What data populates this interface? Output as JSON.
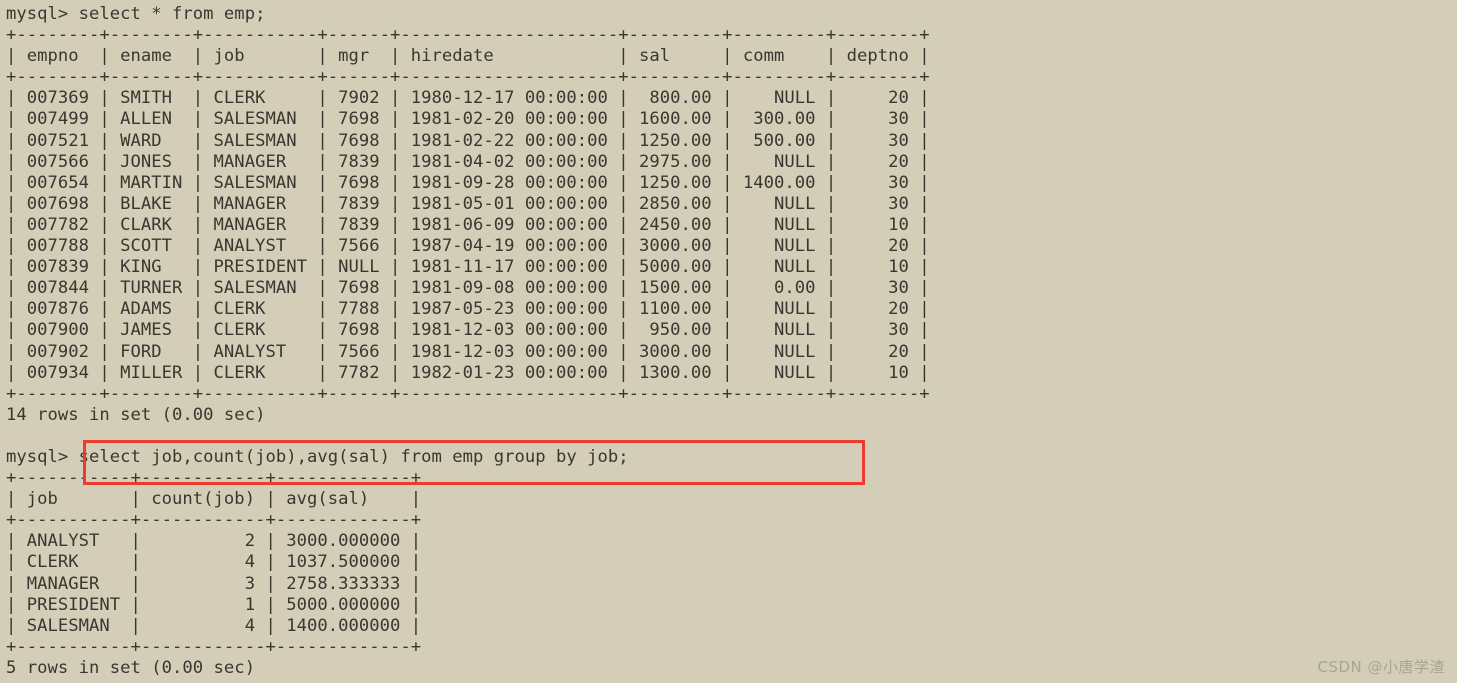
{
  "terminal": {
    "background_color": "#d4cdb8",
    "text_color": "#3b3630",
    "highlight_color": "#ee3b32",
    "prompt": "mysql>",
    "query1": "mysql> select * from emp;",
    "query2_prompt": "mysql>",
    "query2": "select job,count(job),avg(sal) from emp group by job;",
    "query2_full": "mysql> select job,count(job),avg(sal) from emp group by job;",
    "result1_status": "14 rows in set (0.00 sec)",
    "result2_status": "5 rows in set (0.00 sec)"
  },
  "table1": {
    "top_border": "+--------+--------+-----------+------+---------------------+---------+---------+--------+",
    "header": "| empno  | ename  | job       | mgr  | hiredate            | sal     | comm    | deptno |",
    "header_sep": "+--------+--------+-----------+------+---------------------+---------+---------+--------+",
    "bottom_border": "+--------+--------+-----------+------+---------------------+---------+---------+--------+",
    "columns": [
      "empno",
      "ename",
      "job",
      "mgr",
      "hiredate",
      "sal",
      "comm",
      "deptno"
    ],
    "rows": [
      "| 007369 | SMITH  | CLERK     | 7902 | 1980-12-17 00:00:00 |  800.00 |    NULL |     20 |",
      "| 007499 | ALLEN  | SALESMAN  | 7698 | 1981-02-20 00:00:00 | 1600.00 |  300.00 |     30 |",
      "| 007521 | WARD   | SALESMAN  | 7698 | 1981-02-22 00:00:00 | 1250.00 |  500.00 |     30 |",
      "| 007566 | JONES  | MANAGER   | 7839 | 1981-04-02 00:00:00 | 2975.00 |    NULL |     20 |",
      "| 007654 | MARTIN | SALESMAN  | 7698 | 1981-09-28 00:00:00 | 1250.00 | 1400.00 |     30 |",
      "| 007698 | BLAKE  | MANAGER   | 7839 | 1981-05-01 00:00:00 | 2850.00 |    NULL |     30 |",
      "| 007782 | CLARK  | MANAGER   | 7839 | 1981-06-09 00:00:00 | 2450.00 |    NULL |     10 |",
      "| 007788 | SCOTT  | ANALYST   | 7566 | 1987-04-19 00:00:00 | 3000.00 |    NULL |     20 |",
      "| 007839 | KING   | PRESIDENT | NULL | 1981-11-17 00:00:00 | 5000.00 |    NULL |     10 |",
      "| 007844 | TURNER | SALESMAN  | 7698 | 1981-09-08 00:00:00 | 1500.00 |    0.00 |     30 |",
      "| 007876 | ADAMS  | CLERK     | 7788 | 1987-05-23 00:00:00 | 1100.00 |    NULL |     20 |",
      "| 007900 | JAMES  | CLERK     | 7698 | 1981-12-03 00:00:00 |  950.00 |    NULL |     30 |",
      "| 007902 | FORD   | ANALYST   | 7566 | 1981-12-03 00:00:00 | 3000.00 |    NULL |     20 |",
      "| 007934 | MILLER | CLERK     | 7782 | 1982-01-23 00:00:00 | 1300.00 |    NULL |     10 |"
    ],
    "records": [
      {
        "empno": "007369",
        "ename": "SMITH",
        "job": "CLERK",
        "mgr": "7902",
        "hiredate": "1980-12-17 00:00:00",
        "sal": "800.00",
        "comm": "NULL",
        "deptno": "20"
      },
      {
        "empno": "007499",
        "ename": "ALLEN",
        "job": "SALESMAN",
        "mgr": "7698",
        "hiredate": "1981-02-20 00:00:00",
        "sal": "1600.00",
        "comm": "300.00",
        "deptno": "30"
      },
      {
        "empno": "007521",
        "ename": "WARD",
        "job": "SALESMAN",
        "mgr": "7698",
        "hiredate": "1981-02-22 00:00:00",
        "sal": "1250.00",
        "comm": "500.00",
        "deptno": "30"
      },
      {
        "empno": "007566",
        "ename": "JONES",
        "job": "MANAGER",
        "mgr": "7839",
        "hiredate": "1981-04-02 00:00:00",
        "sal": "2975.00",
        "comm": "NULL",
        "deptno": "20"
      },
      {
        "empno": "007654",
        "ename": "MARTIN",
        "job": "SALESMAN",
        "mgr": "7698",
        "hiredate": "1981-09-28 00:00:00",
        "sal": "1250.00",
        "comm": "1400.00",
        "deptno": "30"
      },
      {
        "empno": "007698",
        "ename": "BLAKE",
        "job": "MANAGER",
        "mgr": "7839",
        "hiredate": "1981-05-01 00:00:00",
        "sal": "2850.00",
        "comm": "NULL",
        "deptno": "30"
      },
      {
        "empno": "007782",
        "ename": "CLARK",
        "job": "MANAGER",
        "mgr": "7839",
        "hiredate": "1981-06-09 00:00:00",
        "sal": "2450.00",
        "comm": "NULL",
        "deptno": "10"
      },
      {
        "empno": "007788",
        "ename": "SCOTT",
        "job": "ANALYST",
        "mgr": "7566",
        "hiredate": "1987-04-19 00:00:00",
        "sal": "3000.00",
        "comm": "NULL",
        "deptno": "20"
      },
      {
        "empno": "007839",
        "ename": "KING",
        "job": "PRESIDENT",
        "mgr": "NULL",
        "hiredate": "1981-11-17 00:00:00",
        "sal": "5000.00",
        "comm": "NULL",
        "deptno": "10"
      },
      {
        "empno": "007844",
        "ename": "TURNER",
        "job": "SALESMAN",
        "mgr": "7698",
        "hiredate": "1981-09-08 00:00:00",
        "sal": "1500.00",
        "comm": "0.00",
        "deptno": "30"
      },
      {
        "empno": "007876",
        "ename": "ADAMS",
        "job": "CLERK",
        "mgr": "7788",
        "hiredate": "1987-05-23 00:00:00",
        "sal": "1100.00",
        "comm": "NULL",
        "deptno": "20"
      },
      {
        "empno": "007900",
        "ename": "JAMES",
        "job": "CLERK",
        "mgr": "7698",
        "hiredate": "1981-12-03 00:00:00",
        "sal": "950.00",
        "comm": "NULL",
        "deptno": "30"
      },
      {
        "empno": "007902",
        "ename": "FORD",
        "job": "ANALYST",
        "mgr": "7566",
        "hiredate": "1981-12-03 00:00:00",
        "sal": "3000.00",
        "comm": "NULL",
        "deptno": "20"
      },
      {
        "empno": "007934",
        "ename": "MILLER",
        "job": "CLERK",
        "mgr": "7782",
        "hiredate": "1982-01-23 00:00:00",
        "sal": "1300.00",
        "comm": "NULL",
        "deptno": "10"
      }
    ]
  },
  "table2": {
    "top_border": "+-----------+------------+-------------+",
    "header": "| job       | count(job) | avg(sal)    |",
    "header_sep": "+-----------+------------+-------------+",
    "bottom_border": "+-----------+------------+-------------+",
    "columns": [
      "job",
      "count(job)",
      "avg(sal)"
    ],
    "rows": [
      "| ANALYST   |          2 | 3000.000000 |",
      "| CLERK     |          4 | 1037.500000 |",
      "| MANAGER   |          3 | 2758.333333 |",
      "| PRESIDENT |          1 | 5000.000000 |",
      "| SALESMAN  |          4 | 1400.000000 |"
    ],
    "records": [
      {
        "job": "ANALYST",
        "count": "2",
        "avg": "3000.000000"
      },
      {
        "job": "CLERK",
        "count": "4",
        "avg": "1037.500000"
      },
      {
        "job": "MANAGER",
        "count": "3",
        "avg": "2758.333333"
      },
      {
        "job": "PRESIDENT",
        "count": "1",
        "avg": "5000.000000"
      },
      {
        "job": "SALESMAN",
        "count": "4",
        "avg": "1400.000000"
      }
    ]
  },
  "watermark": {
    "text": "CSDN @小唐学渣"
  }
}
